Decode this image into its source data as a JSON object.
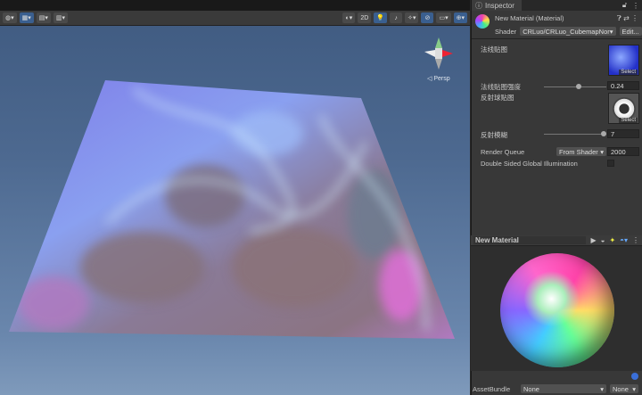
{
  "scene": {
    "toolbar": {
      "mode_2d": "2D"
    },
    "persp_label": "◁ Persp"
  },
  "inspector": {
    "tab": "Inspector",
    "title": "New Material (Material)",
    "shader_label": "Shader",
    "shader_value": "CRLuo/CRLuo_CubemapNor",
    "edit_label": "Edit...",
    "props": {
      "normal_map": "法线贴图",
      "normal_strength": "法线贴图强度",
      "normal_strength_value": "0.24",
      "normal_strength_fraction": 0.6,
      "reflect_map": "反射球贴图",
      "reflect_blur": "反射模糊",
      "reflect_blur_value": "7",
      "reflect_blur_fraction": 1.0,
      "select": "Select"
    },
    "render_queue_label": "Render Queue",
    "render_queue_mode": "From Shader",
    "render_queue_value": "2000",
    "dsgi_label": "Double Sided Global Illumination"
  },
  "preview": {
    "title": "New Material"
  },
  "assetbundle": {
    "label": "AssetBundle",
    "name": "None",
    "variant": "None"
  }
}
